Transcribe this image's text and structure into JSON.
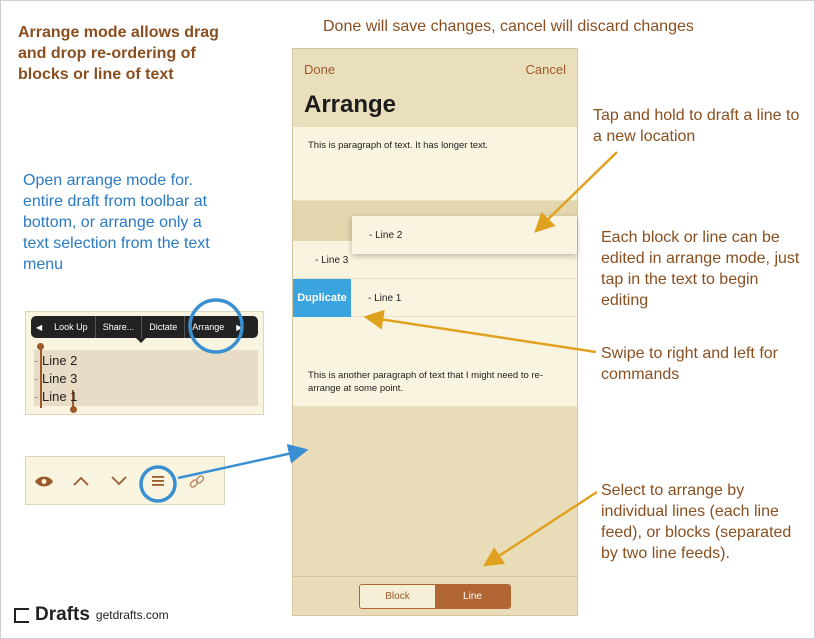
{
  "annotations": {
    "top_heading": "Arrange mode allows drag and drop re-ordering of blocks or line of text",
    "top_center": "Done will save changes, cancel will discard changes",
    "open_mode": "Open arrange mode for. entire draft from toolbar at bottom, or arrange only a text selection from the text menu",
    "tap_hold": "Tap and hold to draft a line to a new location",
    "each_block": "Each block or line can be edited in arrange mode, just tap in the text to begin editing",
    "swipe": "Swipe to right and left for commands",
    "select_arrange": "Select to arrange by individual lines (each line feed), or blocks (separated by two line feeds)."
  },
  "phone": {
    "done_label": "Done",
    "cancel_label": "Cancel",
    "title": "Arrange",
    "block1_text": "This is paragraph of text.  It has longer text.",
    "drag_line": "- Line 2",
    "line3": "- Line 3",
    "duplicate_label": "Duplicate",
    "line1": "- Line 1",
    "block2_text": "This is another paragraph of text that I might need to re-arrange at some point.",
    "segment_block": "Block",
    "segment_line": "Line",
    "selected_segment": "Line"
  },
  "text_menu": {
    "items": [
      "Look Up",
      "Share...",
      "Dictate",
      "Arrange"
    ],
    "lines": [
      "Line 2",
      "Line 3",
      "Line 1"
    ]
  },
  "toolbar": {
    "icons": [
      "eye-icon",
      "chevron-up-icon",
      "chevron-down-icon",
      "arrange-icon",
      "link-icon"
    ]
  },
  "brand": {
    "name": "Drafts",
    "url": "getdrafts.com"
  },
  "colors": {
    "accent_brown": "#8a4f1f",
    "accent_blue": "#2a7bc4",
    "arrow_orange": "#e0a21e",
    "highlight_blue": "#3a8fd0",
    "segment_active": "#b06533"
  }
}
